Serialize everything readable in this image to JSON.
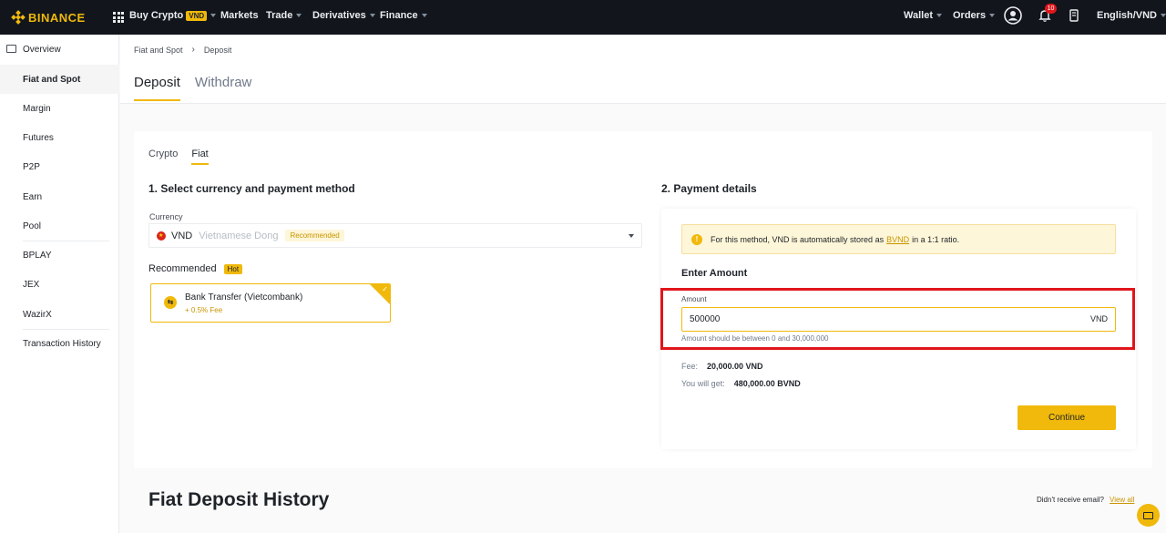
{
  "nav": {
    "logo_text": "BINANCE",
    "items": [
      {
        "label": "Buy Crypto",
        "badge": "VND"
      },
      {
        "label": "Markets"
      },
      {
        "label": "Trade"
      },
      {
        "label": "Derivatives"
      },
      {
        "label": "Finance"
      }
    ],
    "right": {
      "wallet": "Wallet",
      "orders": "Orders",
      "notification_count": "10",
      "language": "English/VND"
    }
  },
  "sidebar": {
    "items": [
      {
        "label": "Overview"
      },
      {
        "label": "Fiat and Spot"
      },
      {
        "label": "Margin"
      },
      {
        "label": "Futures"
      },
      {
        "label": "P2P"
      },
      {
        "label": "Earn"
      },
      {
        "label": "Pool"
      },
      {
        "label": "BPLAY"
      },
      {
        "label": "JEX"
      },
      {
        "label": "WazirX"
      },
      {
        "label": "Transaction History"
      }
    ]
  },
  "breadcrumb": [
    "Fiat and Spot",
    "Deposit"
  ],
  "tabs": [
    "Deposit",
    "Withdraw"
  ],
  "subtabs": [
    "Crypto",
    "Fiat"
  ],
  "step1": {
    "title": "1. Select currency and payment method",
    "currency_label": "Currency",
    "currency_code": "VND",
    "currency_name": "Vietnamese Dong",
    "currency_badge": "Recommended",
    "recommended_label": "Recommended",
    "hot_badge": "Hot",
    "method_name": "Bank Transfer (Vietcombank)",
    "method_fee": "+ 0.5% Fee"
  },
  "step2": {
    "title": "2. Payment details",
    "notice_pre": "For this method, VND is automatically stored as",
    "notice_link": "BVND",
    "notice_post": "in a 1:1 ratio.",
    "enter_amount": "Enter Amount",
    "amount_label": "Amount",
    "amount_value": "500000",
    "amount_unit": "VND",
    "amount_hint": "Amount should be between 0 and 30,000,000",
    "fee_label": "Fee:",
    "fee_value": "20,000.00 VND",
    "get_label": "You will get:",
    "get_value": "480,000.00 BVND",
    "continue_label": "Continue"
  },
  "history": {
    "title": "Fiat Deposit History",
    "email_question": "Didn't receive email?",
    "view_all": "View all"
  },
  "colors": {
    "accent": "#f0b90b",
    "nav_bg": "#12161c",
    "highlight": "#e0161b"
  }
}
